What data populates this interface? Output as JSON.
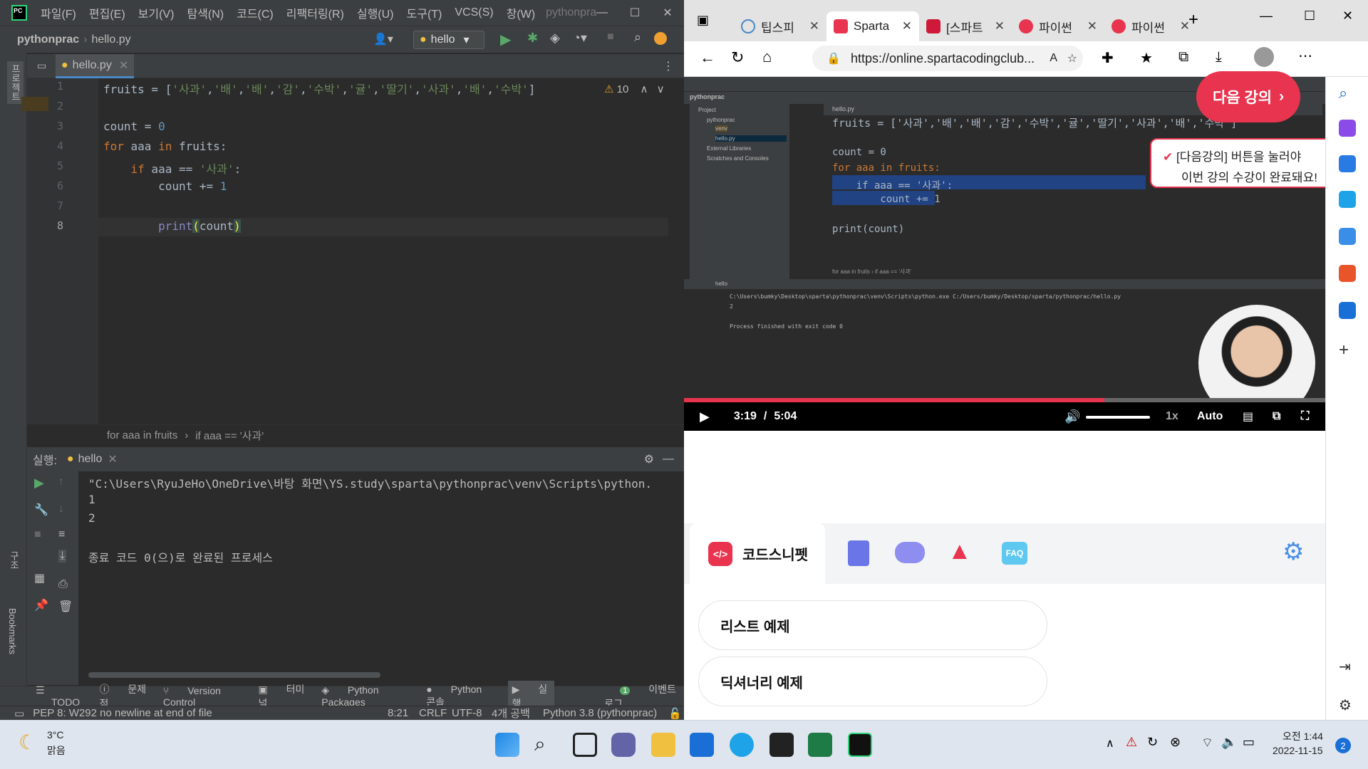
{
  "pycharm": {
    "menu": [
      "파일(F)",
      "편집(E)",
      "보기(V)",
      "탐색(N)",
      "코드(C)",
      "리팩터링(R)",
      "실행(U)",
      "도구(T)",
      "VCS(S)",
      "창(W)"
    ],
    "project_title": "pythonpra",
    "breadcrumb_project": "pythonprac",
    "breadcrumb_file": "hello.py",
    "run_config": "hello",
    "tab_label": "hello.py",
    "warnings": "10",
    "line_numbers": [
      "1",
      "2",
      "3",
      "4",
      "5",
      "6",
      "7",
      "8"
    ],
    "breadcrumb_bottom": [
      "for aaa in fruits",
      "if aaa == '사과'"
    ],
    "run_panel_label": "실행:",
    "run_tab": "hello",
    "output": [
      "\"C:\\Users\\RyuJeHo\\OneDrive\\바탕 화면\\YS.study\\sparta\\pythonprac\\venv\\Scripts\\python.",
      "1",
      "2",
      "",
      "종료 코드 0(으)로 완료된 프로세스"
    ],
    "toolwindows": [
      "TODO",
      "문제점",
      "Version Control",
      "터미널",
      "Python Packages",
      "Python 콘솔",
      "실행",
      "이벤트 로그"
    ],
    "event_count": "1",
    "status_left": "PEP 8: W292 no newline at end of file",
    "status_right": [
      "8:21",
      "CRLF",
      "UTF-8",
      "4개 공백",
      "Python 3.8 (pythonprac)"
    ],
    "left_strip": [
      "프로젝트",
      "구조",
      "Bookmarks"
    ]
  },
  "edge": {
    "tabs": [
      {
        "label": "팁스피",
        "color": "#4a88c7"
      },
      {
        "label": "Sparta",
        "color": "#e8344e"
      },
      {
        "label": "[스파트",
        "color": "#d0183a"
      },
      {
        "label": "파이썬",
        "color": "#e8344e"
      },
      {
        "label": "파이썬",
        "color": "#e8344e"
      }
    ],
    "url": "https://online.spartacodingclub...",
    "next_lecture": "다음 강의",
    "tooltip_line1": "[다음강의] 버튼을 눌러야",
    "tooltip_line2": "이번 강의 수강이 완료돼요!",
    "video": {
      "time_current": "3:19",
      "time_sep": "/",
      "time_total": "5:04",
      "speed": "1x",
      "quality": "Auto",
      "progress": 0.655,
      "code_lines": [
        "fruits = ['사과','배','배','감','수박','귤','딸기','사과','배','수박']",
        "",
        "count = 0",
        "for aaa in fruits:",
        "    if aaa == '사과':",
        "        count += 1",
        "",
        "print(count)"
      ],
      "run_lines": [
        "C:\\Users\\bumky\\Desktop\\sparta\\pythonprac\\venv\\Scripts\\python.exe C:/Users/bumky/Desktop/sparta/pythonprac/hello.py",
        "2",
        "",
        "Process finished with exit code 0"
      ],
      "mini_project": "pythonprac",
      "mini_tab": "hello.py",
      "mini_run": "hello",
      "mini_tree": [
        "Project",
        "pythonprac",
        "venv",
        "hello.py",
        "External Libraries",
        "Scratches and Consoles"
      ],
      "mini_crumbs": "for aaa in fruits  ›  if aaa == '사과'"
    },
    "codesnippet_label": "코드스니펫",
    "faq_label": "FAQ",
    "examples": [
      "리스트 예제",
      "딕셔너리 예제"
    ]
  },
  "taskbar": {
    "weather_temp": "3°C",
    "weather_desc": "맑음",
    "time": "오전 1:44",
    "date": "2022-11-15",
    "notif": "2"
  }
}
